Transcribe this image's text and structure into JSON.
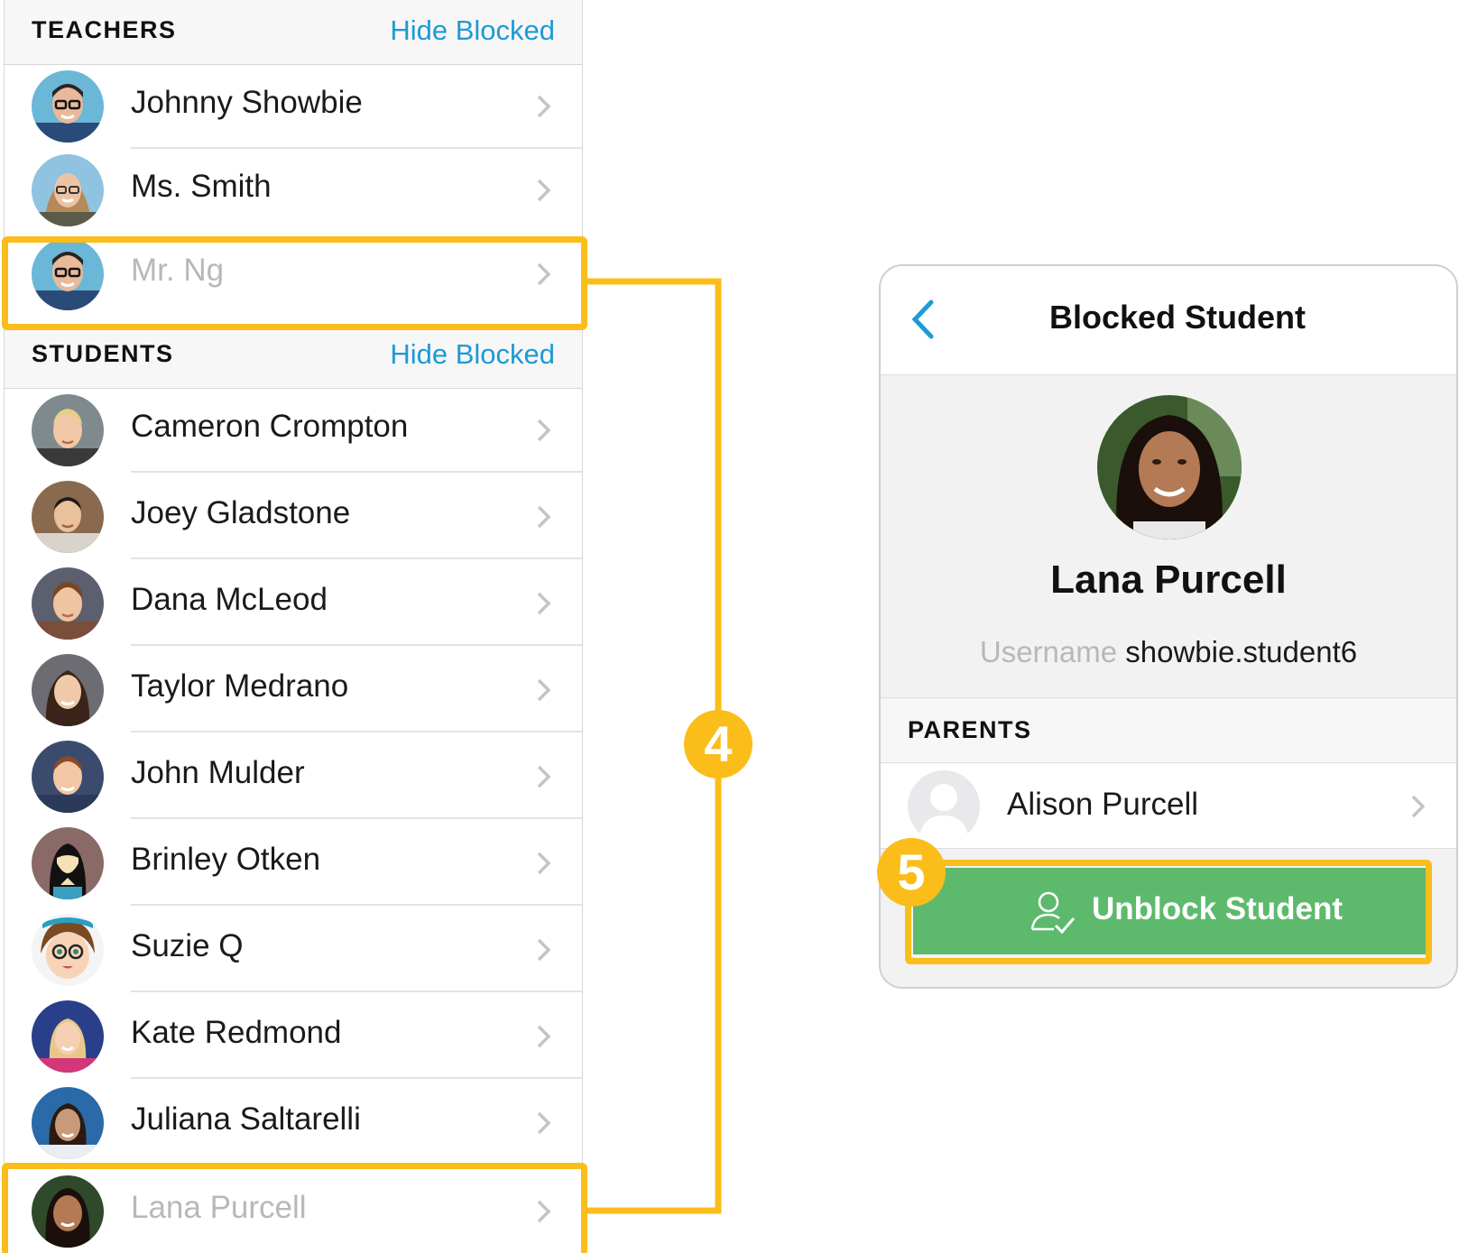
{
  "teachers": {
    "header": "TEACHERS",
    "hide_link": "Hide Blocked",
    "items": [
      {
        "name": "Johnny Showbie",
        "blocked": false
      },
      {
        "name": "Ms. Smith",
        "blocked": false
      },
      {
        "name": "Mr. Ng",
        "blocked": true
      }
    ]
  },
  "students": {
    "header": "STUDENTS",
    "hide_link": "Hide Blocked",
    "items": [
      {
        "name": "Cameron Crompton",
        "blocked": false
      },
      {
        "name": "Joey Gladstone",
        "blocked": false
      },
      {
        "name": "Dana McLeod",
        "blocked": false
      },
      {
        "name": "Taylor Medrano",
        "blocked": false
      },
      {
        "name": "John Mulder",
        "blocked": false
      },
      {
        "name": "Brinley Otken",
        "blocked": false
      },
      {
        "name": "Suzie Q",
        "blocked": false
      },
      {
        "name": "Kate Redmond",
        "blocked": false
      },
      {
        "name": "Juliana Saltarelli",
        "blocked": false
      },
      {
        "name": "Lana Purcell",
        "blocked": true
      }
    ]
  },
  "steps": {
    "step4": "4",
    "step5": "5"
  },
  "detail": {
    "title": "Blocked Student",
    "student_name": "Lana Purcell",
    "username_label": "Username",
    "username_value": "showbie.student6",
    "parents_header": "PARENTS",
    "parent_name": "Alison Purcell",
    "unblock_label": "Unblock Student"
  },
  "colors": {
    "accent_blue": "#1e9ad6",
    "highlight_yellow": "#fbbd1a",
    "unblock_green": "#5dba6c"
  }
}
